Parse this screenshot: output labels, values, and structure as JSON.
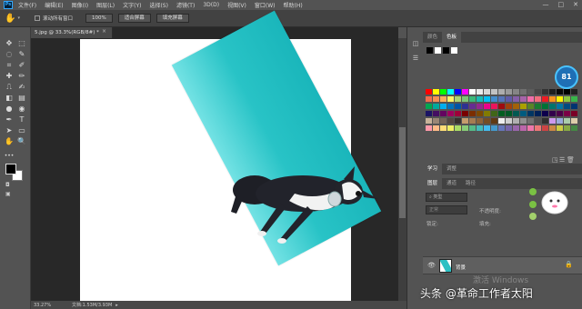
{
  "menu": {
    "items": [
      "文件(F)",
      "编辑(E)",
      "图像(I)",
      "图层(L)",
      "文字(Y)",
      "选择(S)",
      "滤镜(T)",
      "3D(D)",
      "视图(V)",
      "窗口(W)",
      "帮助(H)"
    ]
  },
  "window_controls": {
    "minimize": "—",
    "maximize": "□",
    "close": "✕"
  },
  "options": {
    "scroll_all_label": "滚动所有窗口",
    "zoom_value": "100%",
    "fit_screen": "适合屏幕",
    "fill_screen": "填充屏幕"
  },
  "document": {
    "tab_title": "5.jpg @ 33.3%(RGB/8#) *"
  },
  "status": {
    "zoom": "33.27%",
    "doc_info": "文档:1.53M/3.93M"
  },
  "panels": {
    "color_tabs": [
      "颜色",
      "色板"
    ],
    "learn_tabs": [
      "学习",
      "调整"
    ],
    "layer_tabs": [
      "图层",
      "通道",
      "路径"
    ],
    "kind_label": "类型",
    "mode_label": "正常",
    "opacity_label": "不透明度:",
    "lock_label": "锁定:",
    "fill_label": "填充:",
    "layer_name": "背景"
  },
  "gauge": {
    "value": "81"
  },
  "overlay": {
    "activate": "激活 Windows",
    "watermark": "头条 @革命工作者太阳"
  },
  "colors": {
    "app_bg": "#535353",
    "canvas_bg": "#282828",
    "photo_teal": "#1ab6bb",
    "gauge_blue": "#1f6fb5"
  },
  "icons": [
    "ps-logo-icon",
    "hand-tool-icon",
    "move-tool-icon",
    "marquee-tool-icon",
    "lasso-tool-icon",
    "quick-select-tool-icon",
    "crop-tool-icon",
    "eyedropper-tool-icon",
    "brush-tool-icon",
    "clone-stamp-tool-icon",
    "eraser-tool-icon",
    "gradient-tool-icon",
    "dodge-tool-icon",
    "pen-tool-icon",
    "type-tool-icon",
    "path-select-tool-icon",
    "rectangle-tool-icon",
    "zoom-tool-icon",
    "eye-icon",
    "lock-icon"
  ]
}
